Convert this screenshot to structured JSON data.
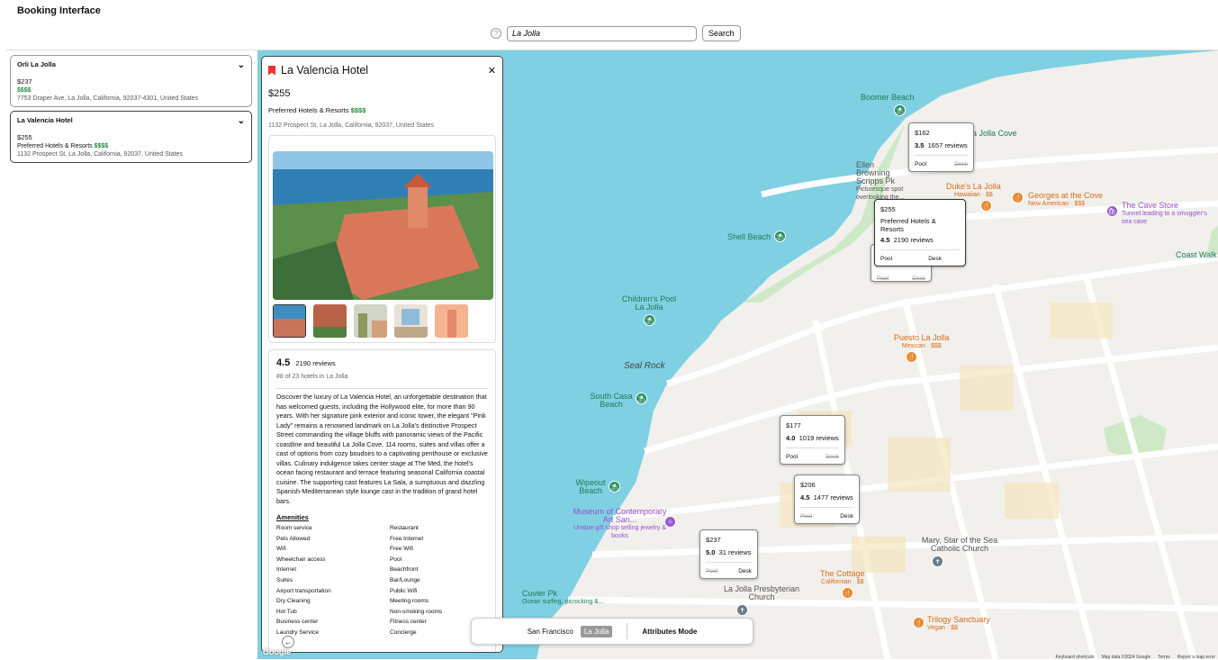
{
  "app_title": "Booking Interface",
  "search": {
    "help": "?",
    "value": "La Jolla",
    "button": "Search"
  },
  "hotels": [
    {
      "name": "Orli La Jolla",
      "price": "$237",
      "brand": "",
      "tier": "$$$$",
      "address": "7753 Draper Ave, La Jolla, California, 92037-4301, United States"
    },
    {
      "name": "La Valencia Hotel",
      "price": "$255",
      "brand": "Preferred Hotels & Resorts",
      "tier": "$$$$",
      "address": "1132 Prospect St, La Jolla, California, 92037, United States"
    }
  ],
  "detail": {
    "title": "La Valencia Hotel",
    "close": "✕",
    "price": "$255",
    "brand": "Preferred Hotels & Resorts",
    "tier": "$$$$",
    "address": "1132 Prospect St, La Jolla, California, 92037, United States",
    "rating": "4.5",
    "reviews": "2190 reviews",
    "rank": "#8 of 23 hotels in La Jolla",
    "description": "Discover the luxury of La Valencia Hotel, an unforgettable destination that has welcomed guests, including the Hollywood elite, for more than 90 years. With her signature pink exterior and iconic tower, the elegant \"Pink Lady\" remains a renowned landmark on La Jolla's distinctive Prospect Street commanding the village bluffs with panoramic views of the Pacific coastline and beautiful La Jolla Cove. 114 rooms, suites and villas offer a cast of options from cozy boudoirs to a captivating penthouse or exclusive villas. Culinary indulgence takes center stage at The Med, the hotel's ocean facing restaurant and terrace featuring seasonal California coastal cuisine. The supporting cast features La Sala, a sumptuous and dazzling Spanish-Mediterranean style lounge cast in the tradition of grand hotel bars.",
    "amenities_title": "Amenities",
    "amenities": [
      "Room service",
      "Restaurant",
      "Pets Allowed",
      "Free Internet",
      "Wifi",
      "Free Wifi",
      "Wheelchair access",
      "Pool",
      "Internet",
      "Beachfront",
      "Suites",
      "Bar/Lounge",
      "Airport transportation",
      "Public Wifi",
      "Dry Cleaning",
      "Meeting rooms",
      "Hot Tub",
      "Non-smoking rooms",
      "Business center",
      "Fitness center",
      "Laundry Service",
      "Concierge"
    ]
  },
  "map_cards": [
    {
      "price": "$162",
      "rating": "3.5",
      "reviews": "1657 reviews",
      "brand": "",
      "pool": "Pool",
      "desk": "Desk",
      "pool_off": false,
      "desk_off": true
    },
    {
      "price": "$255",
      "rating": "4.5",
      "reviews": "2190 reviews",
      "brand": "Preferred Hotels & Resorts",
      "pool": "Pool",
      "desk": "Desk",
      "pool_off": false,
      "desk_off": false
    },
    {
      "price": "$177",
      "rating": "4.0",
      "reviews": "1019 reviews",
      "brand": "",
      "pool": "Pool",
      "desk": "Desk",
      "pool_off": false,
      "desk_off": true
    },
    {
      "price": "$206",
      "rating": "4.5",
      "reviews": "1477 reviews",
      "brand": "",
      "pool": "Pool",
      "desk": "Desk",
      "pool_off": true,
      "desk_off": false
    },
    {
      "price": "$237",
      "rating": "5.0",
      "reviews": "31 reviews",
      "brand": "",
      "pool": "Pool",
      "desk": "Desk",
      "pool_off": true,
      "desk_off": false
    }
  ],
  "shadow_card": {
    "pool": "Pool",
    "desk": "Desk"
  },
  "map_labels": {
    "boomer": "Boomer Beach",
    "cove": "a Jolla Cove",
    "ellen": "Ellen Browning Scripps Pk",
    "ellen_sub": "Picturesque spot overlooking the...",
    "dukes": "Duke's La Jolla",
    "dukes_sub": "Hawaiian · $$",
    "georges": "Georges at the Cove",
    "georges_sub": "New American · $$$",
    "cave": "The Cave Store",
    "cave_sub": "Tunnel leading to a smuggler's sea cave",
    "shell": "Shell Beach",
    "coast": "Coast Walk",
    "childrens": "Children's Pool La Jolla",
    "puesto": "Puesto La Jolla",
    "puesto_sub": "Mexican · $$$",
    "seal": "Seal Rock",
    "south_casa": "South Casa Beach",
    "wipeout": "Wipeout Beach",
    "museum": "Museum of Contemporary Art San...",
    "museum_sub": "Unique gift shop selling jewelry & books",
    "mary": "Mary, Star of the Sea Catholic Church",
    "cottage": "The Cottage",
    "cottage_sub": "Californian · $$",
    "presby": "La Jolla Presbyterian Church",
    "cuvier": "Cuvier Pk",
    "cuvier_sub": "Ocean surfing, picnicking &...",
    "trilogy": "Trilogy Sanctuary",
    "trilogy_sub": "Vegan · $$"
  },
  "bottom_bar": {
    "city1": "San Francisco",
    "city2": "La Jolla",
    "mode": "Attributes Mode"
  },
  "footer": {
    "keys": "Keyboard shortcuts",
    "mapdata": "Map data ©2024 Google",
    "terms": "Terms",
    "report": "Report a map error",
    "google": "Google"
  },
  "icons": {
    "chevron": "chevron-down-icon",
    "bookmark": "bookmark-icon",
    "back": "arrow-left-icon"
  }
}
